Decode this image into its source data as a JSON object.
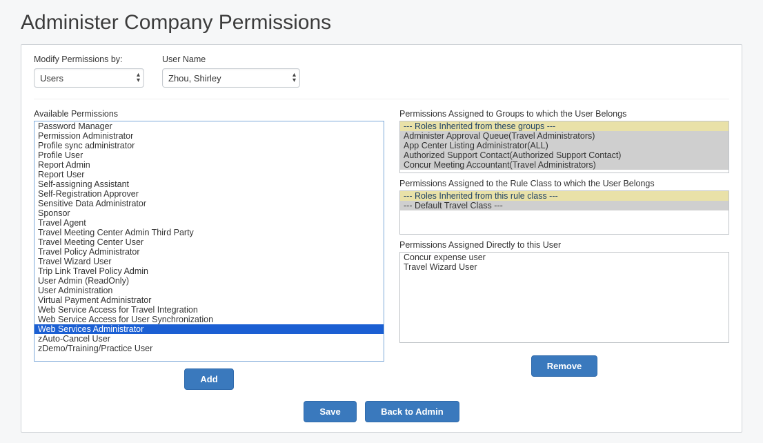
{
  "title": "Administer Company Permissions",
  "filters": {
    "modifyby_label": "Modify Permissions by:",
    "modifyby_value": "Users",
    "username_label": "User Name",
    "username_value": "Zhou, Shirley"
  },
  "available": {
    "label": "Available Permissions",
    "items": [
      "Password Manager",
      "Permission Administrator",
      "Profile sync administrator",
      "Profile User",
      "Report Admin",
      "Report User",
      "Self-assigning Assistant",
      "Self-Registration Approver",
      "Sensitive Data Administrator",
      "Sponsor",
      "Travel Agent",
      "Travel Meeting Center Admin Third Party",
      "Travel Meeting Center User",
      "Travel Policy Administrator",
      "Travel Wizard User",
      "Trip Link Travel Policy Admin",
      "User Admin (ReadOnly)",
      "User Administration",
      "Virtual Payment Administrator",
      "Web Service Access for Travel Integration",
      "Web Service Access for User Synchronization",
      "Web Services Administrator",
      "zAuto-Cancel User",
      "zDemo/Training/Practice User"
    ],
    "selected_index": 21
  },
  "groups": {
    "label": "Permissions Assigned to Groups to which the User Belongs",
    "header": "--- Roles Inherited from these groups ---",
    "items": [
      "Administer Approval Queue(Travel Administrators)",
      "App Center Listing Administrator(ALL)",
      "Authorized Support Contact(Authorized Support Contact)",
      "Concur Meeting Accountant(Travel Administrators)"
    ]
  },
  "ruleclass": {
    "label": "Permissions Assigned to the Rule Class to which the User Belongs",
    "header": "--- Roles Inherited from this rule class ---",
    "items": [
      "--- Default Travel Class ---"
    ]
  },
  "direct": {
    "label": "Permissions Assigned Directly to this User",
    "items": [
      "Concur expense user",
      "Travel Wizard User"
    ]
  },
  "buttons": {
    "add": "Add",
    "remove": "Remove",
    "save": "Save",
    "back": "Back to Admin"
  }
}
